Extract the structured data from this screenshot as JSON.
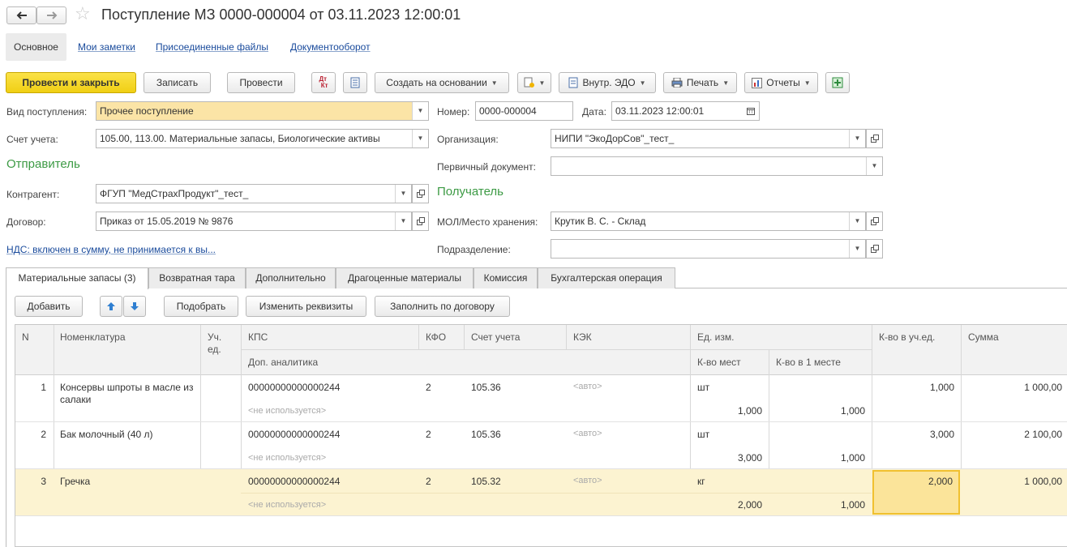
{
  "window": {
    "title": "Поступление МЗ 0000-000004 от 03.11.2023 12:00:01"
  },
  "top_tabs": [
    "Основное",
    "Мои заметки",
    "Присоединенные файлы",
    "Документооборот"
  ],
  "toolbar": {
    "post_close": "Провести и закрыть",
    "save": "Записать",
    "post": "Провести",
    "create_based": "Создать на основании",
    "edo": "Внутр. ЭДО",
    "print": "Печать",
    "reports": "Отчеты"
  },
  "form": {
    "receipt_type_label": "Вид поступления:",
    "receipt_type_value": "Прочее поступление",
    "number_label": "Номер:",
    "number_value": "0000-000004",
    "date_label": "Дата:",
    "date_value": "03.11.2023 12:00:01",
    "account_label": "Счет учета:",
    "account_value": "105.00, 113.00. Материальные запасы, Биологические активы",
    "org_label": "Организация:",
    "org_value": "НИПИ \"ЭкоДорСов\"_тест_",
    "sender_heading": "Отправитель",
    "primary_doc_label": "Первичный документ:",
    "primary_doc_value": "",
    "contractor_label": "Контрагент:",
    "contractor_value": "ФГУП \"МедСтрахПродукт\"_тест_",
    "receiver_heading": "Получатель",
    "contract_label": "Договор:",
    "contract_value": "Приказ от 15.05.2019 № 9876",
    "mol_label": "МОЛ/Место хранения:",
    "mol_value": "Крутик В. С. - Склад",
    "vat_link": "НДС: включен в сумму, не принимается к вы...",
    "division_label": "Подразделение:",
    "division_value": ""
  },
  "panel_tabs": [
    "Материальные запасы (3)",
    "Возвратная тара",
    "Дополнительно",
    "Драгоценные материалы",
    "Комиссия",
    "Бухгалтерская операция"
  ],
  "table_toolbar": {
    "add": "Добавить",
    "pick": "Подобрать",
    "change_props": "Изменить реквизиты",
    "fill_contract": "Заполнить по договору"
  },
  "table": {
    "headers": {
      "n": "N",
      "nomenclature": "Номенклатура",
      "unit": "Уч. ед.",
      "kps": "КПС",
      "extra": "Доп. аналитика",
      "kfo": "КФО",
      "account": "Счет учета",
      "kek": "КЭК",
      "uom": "Ед. изм.",
      "places": "К-во мест",
      "per_place": "К-во в 1 месте",
      "qty": "К-во в уч.ед.",
      "sum": "Сумма"
    },
    "rows": [
      {
        "n": "1",
        "name": "Консервы шпроты в масле из салаки",
        "kps": "00000000000000244",
        "extra": "<не используется>",
        "kfo": "2",
        "account": "105.36",
        "kek": "<авто>",
        "uom": "шт",
        "places": "1,000",
        "per_place": "1,000",
        "qty": "1,000",
        "sum": "1 000,00"
      },
      {
        "n": "2",
        "name": "Бак молочный (40 л)",
        "kps": "00000000000000244",
        "extra": "<не используется>",
        "kfo": "2",
        "account": "105.36",
        "kek": "<авто>",
        "uom": "шт",
        "places": "3,000",
        "per_place": "1,000",
        "qty": "3,000",
        "sum": "2 100,00"
      },
      {
        "n": "3",
        "name": "Гречка",
        "kps": "00000000000000244",
        "extra": "<не используется>",
        "kfo": "2",
        "account": "105.32",
        "kek": "<авто>",
        "uom": "кг",
        "places": "2,000",
        "per_place": "1,000",
        "qty": "2,000",
        "sum": "1 000,00"
      }
    ]
  }
}
